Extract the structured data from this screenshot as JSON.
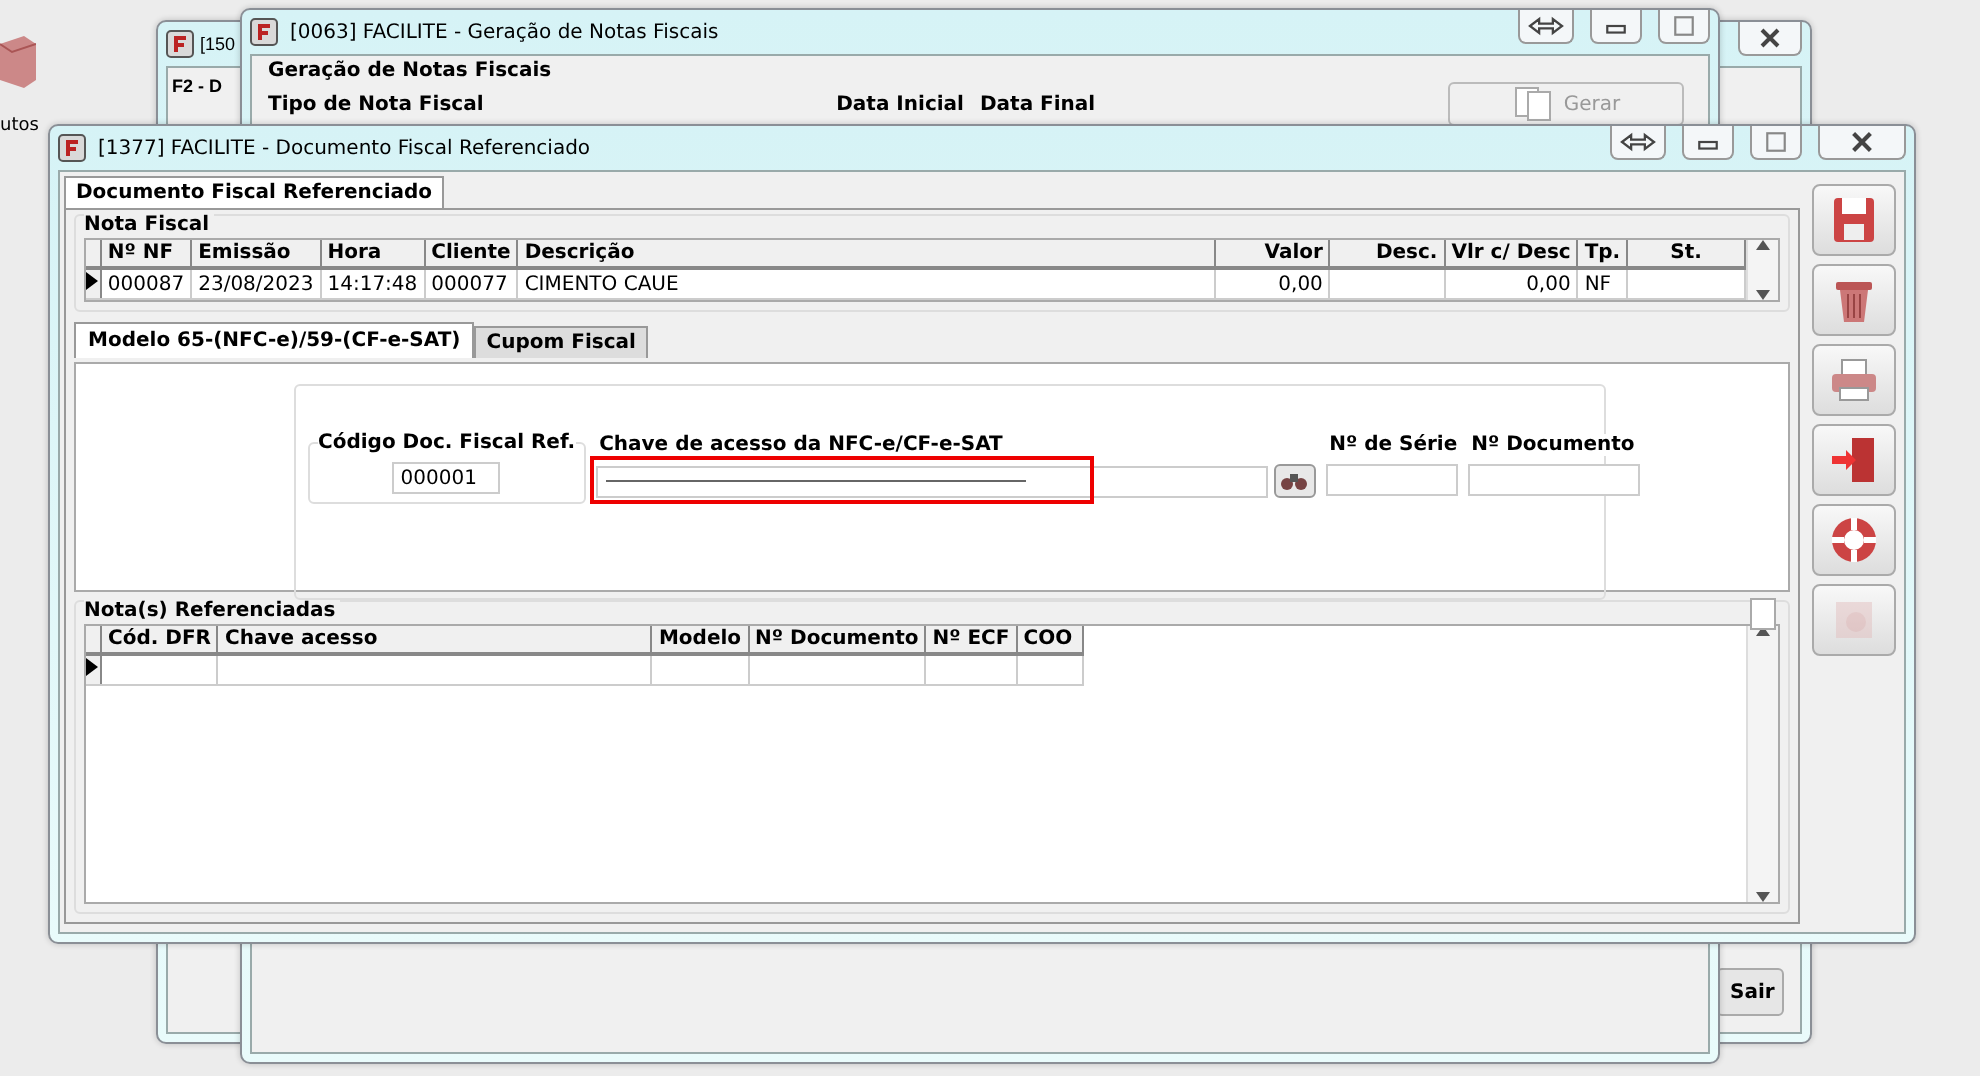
{
  "desktop": {
    "icon_label": "utos"
  },
  "back_window_1": {
    "title": "[150",
    "text": "F2 - D",
    "exit_button": "Sair"
  },
  "back_window_2": {
    "title": "[0063] FACILITE - Geração de Notas Fiscais",
    "group_title": "Geração de Notas Fiscais",
    "type_label": "Tipo de Nota Fiscal",
    "date_start_label": "Data Inicial",
    "date_end_label": "Data Final",
    "generate_button": {
      "label": "Gerar",
      "disabled": true
    }
  },
  "window": {
    "title": "[1377] FACILITE - Documento Fiscal Referenciado",
    "tab": "Documento Fiscal Referenciado",
    "nota_fiscal": {
      "title": "Nota Fiscal",
      "columns": [
        "Nº NF",
        "Emissão",
        "Hora",
        "Cliente",
        "Descrição",
        "Valor",
        "Desc.",
        "Vlr c/ Desc",
        "Tp.",
        "St."
      ],
      "rows": [
        [
          "000087",
          "23/08/2023",
          "14:17:48",
          "000077",
          "CIMENTO CAUE",
          "0,00",
          "",
          "0,00",
          "NF",
          ""
        ]
      ]
    },
    "subtabs": [
      {
        "label": "Modelo 65-(NFC-e)/59-(CF-e-SAT)",
        "selected": true
      },
      {
        "label": "Cupom Fiscal",
        "selected": false
      }
    ],
    "code_field": {
      "label": "Código Doc. Fiscal Ref.",
      "value": "000001"
    },
    "key_field": {
      "label": "Chave de acesso da NFC-e/CF-e-SAT",
      "highlighted": true
    },
    "series_field": {
      "label": "Nº de Série"
    },
    "document_field": {
      "label": "Nº Documento"
    },
    "referenced": {
      "title": "Nota(s) Referenciadas",
      "columns": [
        "Cód. DFR",
        "Chave acesso",
        "Modelo",
        "Nº Documento",
        "Nº ECF",
        "COO"
      ]
    },
    "toolbar": [
      {
        "kind": "save",
        "disabled": false
      },
      {
        "kind": "delete",
        "disabled": false
      },
      {
        "kind": "print",
        "disabled": false
      },
      {
        "kind": "exit",
        "disabled": false
      },
      {
        "kind": "help",
        "disabled": false
      },
      {
        "kind": "settings",
        "disabled": true
      }
    ]
  }
}
